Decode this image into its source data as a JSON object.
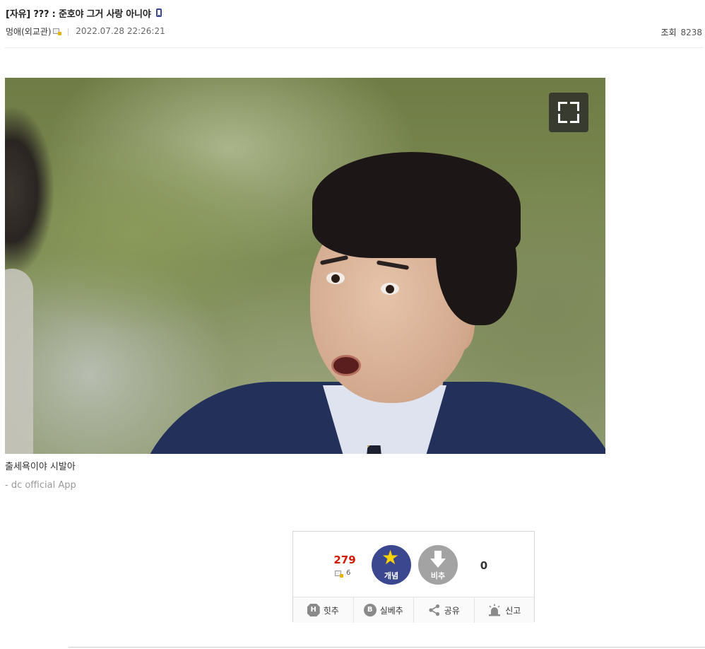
{
  "post": {
    "title": "[자유] ??? : 준호야 그거 사랑 아니야",
    "author": "멍애(외교관)",
    "date": "2022.07.28 22:26:21",
    "views_label": "조회",
    "views": "8238",
    "body_text": "출세욕이야 시발아",
    "app_signature": "- dc official App"
  },
  "icons": {
    "mobile": "mobile-phone-icon",
    "nick": "fixed-nick-icon",
    "fullscreen": "fullscreen-icon"
  },
  "vote": {
    "up_count": "279",
    "fixed_nick_up_count": "6",
    "up_label": "개념",
    "down_label": "비추",
    "down_count": "0",
    "actions": [
      {
        "icon_text": "H",
        "label": "힛추"
      },
      {
        "icon_text": "B",
        "label": "실베추"
      },
      {
        "label": "공유"
      },
      {
        "label": "신고"
      }
    ]
  },
  "colors": {
    "accent": "#3b4890",
    "up_count": "#d31900",
    "down_button": "#a3a3a3",
    "star": "#ffd200"
  }
}
